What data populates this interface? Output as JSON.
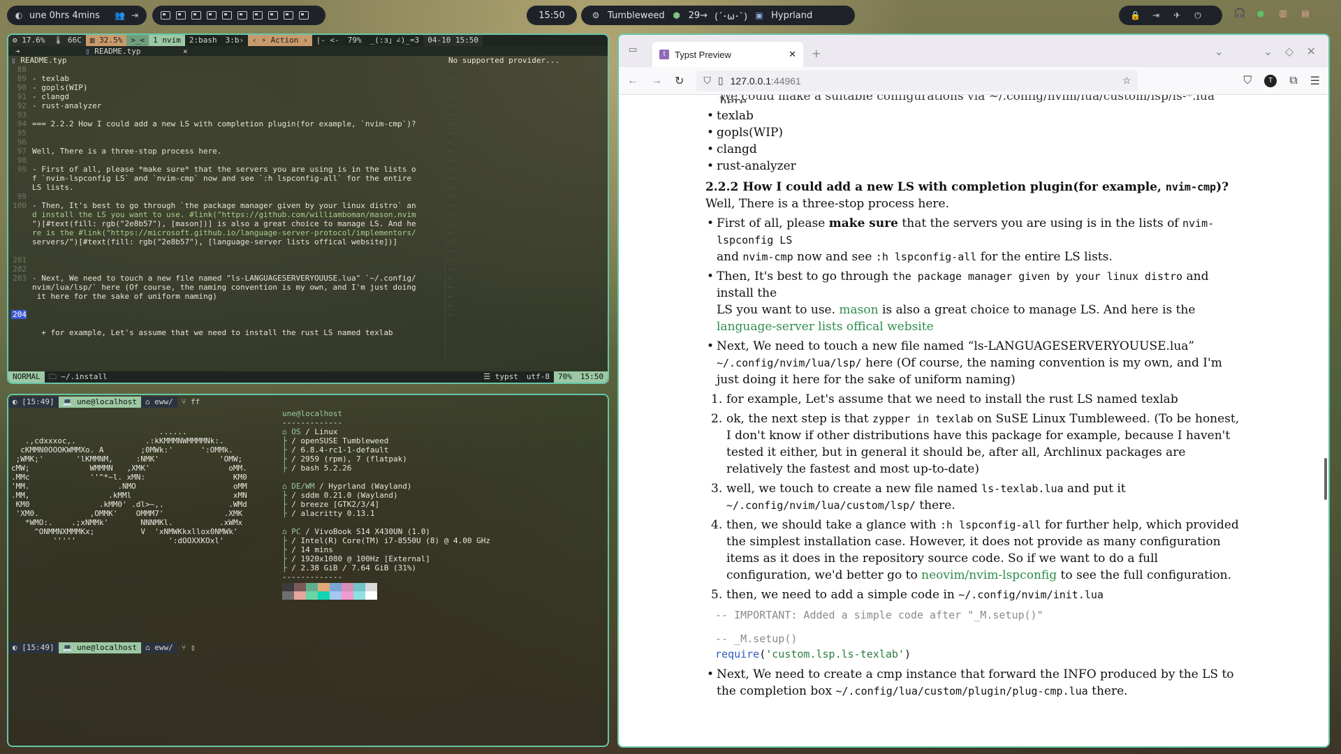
{
  "topbar": {
    "user_uptime": "une 0hrs  4mins",
    "workspace_count": 10,
    "clock": "15:50",
    "distro": "Tumbleweed",
    "updates": "29→",
    "face": "(´･ω･`)",
    "wm": "Hyprland"
  },
  "nvim": {
    "statusbar_top": {
      "cpu": "17.6%",
      "temp": "66C",
      "mem": "32.5%",
      "mode_glyph": ">_<",
      "tab1": "1 nvim",
      "tab2": "2:bash",
      "tab3": "3:b›",
      "action": "Action",
      "arrows": "|- <-",
      "percent": "79%",
      "misc": "_(:з」∠)_=3",
      "datetime": "04-10 15:50"
    },
    "tabline_file": "README.typ",
    "tabline_tab": "README.typ",
    "side_panel_text": "No supported provider...",
    "lines": [
      {
        "n": "88",
        "t": ""
      },
      {
        "n": "89",
        "t": "- texlab"
      },
      {
        "n": "90",
        "t": "- gopls(WIP)"
      },
      {
        "n": "91",
        "t": "- clangd"
      },
      {
        "n": "92",
        "t": "- rust-analyzer"
      },
      {
        "n": "93",
        "t": ""
      },
      {
        "n": "94",
        "t": "=== 2.2.2 How I could add a new LS with completion plugin(for example, `nvim-cmp`)?"
      },
      {
        "n": "95",
        "t": ""
      },
      {
        "n": "96",
        "t": ""
      },
      {
        "n": "97",
        "t": "Well, There is a three-stop process here."
      },
      {
        "n": "98",
        "t": ""
      },
      {
        "n": "99",
        "t": "- First of all, please *make sure* that the servers you are using is in the lists o"
      },
      {
        "n": "",
        "t": "f `nvim-lspconfig LS` and `nvim-cmp` now and see `:h lspconfig-all` for the entire"
      },
      {
        "n": "",
        "t": "LS lists."
      },
      {
        "n": "99",
        "t": ""
      },
      {
        "n": "100",
        "t": "- Then, It's best to go through `the package manager given by your linux distro` an"
      },
      {
        "n": "",
        "t": "d install the LS you want to use. #link(\"https://github.com/williamboman/mason.nvim"
      },
      {
        "n": "",
        "t": "\")[#text(fill: rgb(\"2e8b57\"), [mason])] is also a great choice to manage LS. And he"
      },
      {
        "n": "",
        "t": "re is the #link(\"https://microsoft.github.io/language-server-protocol/implementors/"
      },
      {
        "n": "",
        "t": "servers/\")[#text(fill: rgb(\"2e8b57\"), [language-server lists offical website])]"
      },
      {
        "n": "",
        "t": ""
      },
      {
        "n": "201",
        "t": ""
      },
      {
        "n": "202",
        "t": ""
      },
      {
        "n": "203",
        "t": "- Next, We need to touch a new file named \"ls-LANGUAGESERVERYOUUSE.lua\" `~/.config/"
      },
      {
        "n": "",
        "t": "nvim/lua/lsp/` here (Of course, the naming convention is my own, and I'm just doing"
      },
      {
        "n": "",
        "t": " it here for the sake of uniform naming)"
      },
      {
        "n": "",
        "t": ""
      },
      {
        "n": "204",
        "t": ""
      },
      {
        "n": "",
        "t": ""
      },
      {
        "n": "",
        "t": "  + for example, Let's assume that we need to install the rust LS named texlab"
      }
    ],
    "status_mode": "NORMAL",
    "status_path": "~/.install",
    "status_ft": "typst",
    "status_enc": "utf-8",
    "status_pct": "70%",
    "status_time": "15:50"
  },
  "terminal": {
    "prompt_time": "[15:49]",
    "prompt_user": "une@localhost",
    "prompt_dir": "eww/",
    "cmd": "ff",
    "ascii": [
      "",
      "",
      "                                ......",
      "   .,cdxxxoc,.               .:kKMMMNWMMMMNk:.",
      "  cKMMN0OOOKWMMXo. A        ;0MWk:'      ':OMMk.",
      " ;WMK;'       'lKMMNM,     :NMK'             'OMW;",
      "cMW;             WMMMN   ,XMK'                 oMM.",
      ".MMc             ''^*~l. xMN:                   KM0",
      "'MM.                   .NMO                     oMM",
      ".MM,                 .kMMl                      xMN",
      " KM0               .kMM0' .dl>~,.              .WMd",
      " 'XM0.           ,OMMK'    OMMM7'             .XMK",
      "   *WMO:.    .;xNMMk'       NNNMKl.          .xWMx",
      "     ^ONMMNXMMMKx;          V  'xNMWKkxllox0NMWk'",
      "         '''''                    ':dOOXXKOxl'"
    ],
    "fetch_title": "une@localhost",
    "fetch_rule": "-------------",
    "fetch": [
      {
        "k": "OS",
        "v": "/ Linux",
        "head": true
      },
      {
        "k": "",
        "v": "/ openSUSE Tumbleweed"
      },
      {
        "k": "",
        "v": "/ 6.8.4-rc1-1-default"
      },
      {
        "k": "",
        "v": "/ 2959 (rpm), 7 (flatpak)"
      },
      {
        "k": "",
        "v": "/ bash 5.2.26"
      },
      {
        "k": "",
        "v": ""
      },
      {
        "k": "DE/WM",
        "v": "/ Hyprland (Wayland)",
        "head": true
      },
      {
        "k": "",
        "v": "/ sddm 0.21.0 (Wayland)"
      },
      {
        "k": "",
        "v": "/ breeze [GTK2/3/4]"
      },
      {
        "k": "",
        "v": "/ alacritty 0.13.1"
      },
      {
        "k": "",
        "v": ""
      },
      {
        "k": "PC",
        "v": "/ VivoBook S14 X430UN (1.0)",
        "head": true
      },
      {
        "k": "",
        "v": "/ Intel(R) Core(TM) i7-8550U (8) @ 4.00 GHz"
      },
      {
        "k": "",
        "v": "/ 14 mins"
      },
      {
        "k": "",
        "v": "/ 1920x1080 @ 100Hz [External]"
      },
      {
        "k": "",
        "v": "/ 2.38 GiB / 7.64 GiB (31%)"
      }
    ],
    "palette_top": [
      "#3b3b3b",
      "#7a5a58",
      "#5fae8e",
      "#e0a878",
      "#7aa6d6",
      "#d58fb8",
      "#6fc4c8",
      "#d9d9d9"
    ],
    "palette_bottom": [
      "#6f6f6f",
      "#e7a59e",
      "#69d6a8",
      "#13d4b0",
      "#a5c8f0",
      "#f09ad0",
      "#8fe0e0",
      "#ffffff"
    ]
  },
  "browser": {
    "tab_title": "Typst Preview",
    "url": "127.0.0.1:44961",
    "url_host": "127.0.0.1",
    "url_port": ":44961",
    "cut_top_line": "We could make a suitable configurations via ~/.config/nvim/lua/custom/lsp/ls-*.lua here.",
    "list1": [
      "texlab",
      "gopls(WIP)",
      "clangd",
      "rust-analyzer"
    ],
    "heading": "2.2.2 How I could add a new LS with completion plugin(for example, ",
    "heading_code": "nvim-cmp",
    "heading_end": ")?",
    "intro": "Well, There is a three-stop process here.",
    "b1_pre": "First of all, please ",
    "b1_bold": "make sure",
    "b1_mid": " that the servers you are using is in the lists of ",
    "b1_code1": "nvim-lspconfig LS",
    "b1_and": "and ",
    "b1_code2": "nvim-cmp",
    "b1_see": " now and see ",
    "b1_code3": ":h lspconfig-all",
    "b1_end": " for the entire LS lists.",
    "b2_pre": "Then, It's best to go through ",
    "b2_code": "the package manager given by your linux distro",
    "b2_mid": " and install the",
    "b2_line2": "LS you want to use. ",
    "b2_link1": "mason",
    "b2_mid2": " is also a great choice to manage LS. And here is the ",
    "b2_link2": "language-server lists offical website",
    "b3_pre": "Next, We need to touch a new file named “ls-LANGUAGESERVERYOUUSE.lua” ",
    "b3_code": "~/.config/nvim/lua/lsp/",
    "b3_end": " here (Of course, the naming convention is my own, and I'm just doing it here for the sake of uniform naming)",
    "o1": "for example, Let's assume that we need to install the rust LS named texlab",
    "o2_pre": "ok, the next step is that ",
    "o2_code": "zypper in texlab",
    "o2_end": " on SuSE Linux Tumbleweed. (To be honest, I don't know if other distributions have this package for example, because I haven't tested it either, but in general it should be, after all, Archlinux packages are relatively the fastest and most up-to-date)",
    "o3_pre": "well, we touch to create a new file named ",
    "o3_code1": "ls-texlab.lua",
    "o3_mid": " and put it ",
    "o3_code2": "~/.config/nvim/lua/custom/lsp/",
    "o3_end": " there.",
    "o4_pre": "then, we should take a glance with ",
    "o4_code": ":h lspconfig-all",
    "o4_end": " for further help, which provided the simplest installation case. However, it does not provide as many configuration items as it does in the repository source code. So if we want to do a full configuration, we'd better go to ",
    "o4_link": "neovim/nvim-lspconfig",
    "o4_tail": " to see the full configuration.",
    "o5_pre": "then, we need to add a simple code in ",
    "o5_code": "~/.config/nvim/init.lua",
    "code1": "-- IMPORTANT: Added a simple code after \"_M.setup()\"",
    "code2": "-- _M.setup()",
    "code3_fn": "require",
    "code3_arg": "'custom.lsp.ls-texlab'",
    "b4_pre": "Next, We need to create a cmp instance that forward the INFO produced by the LS to the completion box ",
    "b4_code": "~/.config/lua/custom/plugin/plug-cmp.lua",
    "b4_end": " there."
  }
}
